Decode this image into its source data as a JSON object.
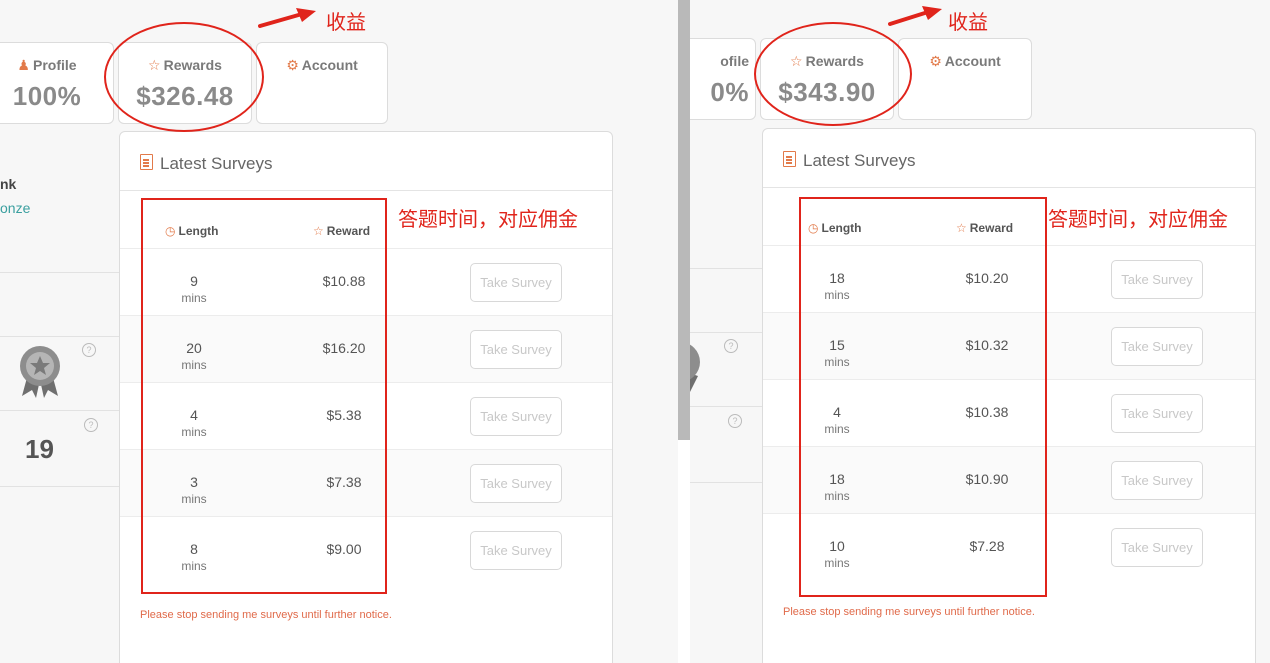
{
  "left": {
    "tabs": {
      "profile": {
        "label": "Profile",
        "value": "100%"
      },
      "rewards": {
        "label": "Rewards",
        "value": "$326.48"
      },
      "account": {
        "label": "Account"
      }
    },
    "sidebar": {
      "name_fragment": "nk",
      "level_fragment": "onze",
      "count": "19"
    },
    "surveys": {
      "title": "Latest Surveys",
      "col_length": "Length",
      "col_reward": "Reward",
      "unit": "mins",
      "button": "Take Survey",
      "rows": [
        {
          "length": "9",
          "reward": "$10.88"
        },
        {
          "length": "20",
          "reward": "$16.20"
        },
        {
          "length": "4",
          "reward": "$5.38"
        },
        {
          "length": "3",
          "reward": "$7.38"
        },
        {
          "length": "8",
          "reward": "$9.00"
        }
      ],
      "notice": "Please stop sending me surveys until further notice."
    },
    "annotations": {
      "earnings": "收益",
      "time_commission": "答题时间，对应佣金"
    }
  },
  "right": {
    "tabs": {
      "profile": {
        "label": "ofile",
        "value": "0%"
      },
      "rewards": {
        "label": "Rewards",
        "value": "$343.90"
      },
      "account": {
        "label": "Account"
      }
    },
    "surveys": {
      "title": "Latest Surveys",
      "col_length": "Length",
      "col_reward": "Reward",
      "unit": "mins",
      "button": "Take Survey",
      "rows": [
        {
          "length": "18",
          "reward": "$10.20"
        },
        {
          "length": "15",
          "reward": "$10.32"
        },
        {
          "length": "4",
          "reward": "$10.38"
        },
        {
          "length": "18",
          "reward": "$10.90"
        },
        {
          "length": "10",
          "reward": "$7.28"
        }
      ],
      "notice": "Please stop sending me surveys until further notice."
    },
    "annotations": {
      "earnings": "收益",
      "time_commission": "答题时间，对应佣金"
    }
  },
  "colors": {
    "accent": "#e27a4a",
    "annotation_red": "#e0241b",
    "notice": "#e06a4a",
    "link": "#3a9f9f"
  },
  "icons": {
    "profile": "user-icon",
    "rewards": "star-icon",
    "account": "gear-icon",
    "length": "clock-icon",
    "survey_title": "document-icon",
    "medal": "badge-icon",
    "help": "question-icon",
    "arrow": "red-arrow"
  }
}
